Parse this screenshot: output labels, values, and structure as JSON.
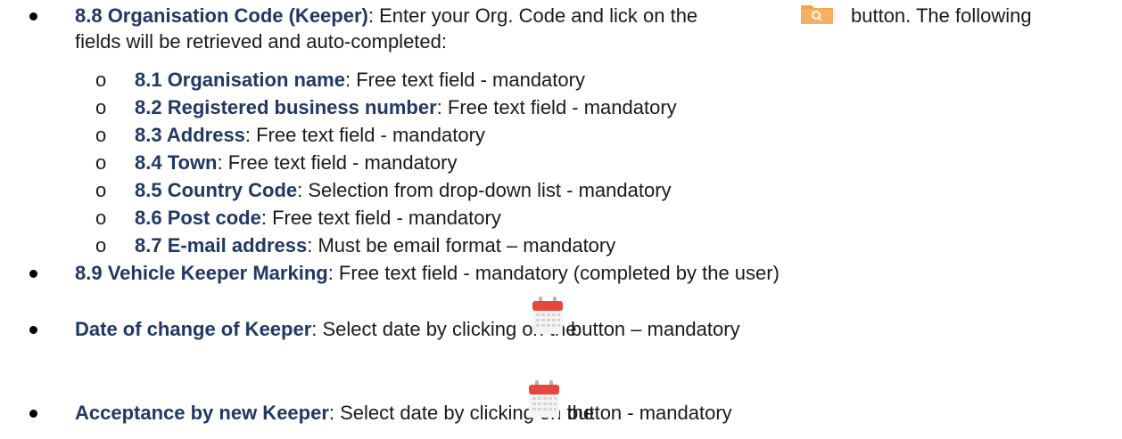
{
  "items": [
    {
      "title": "8.8 Organisation Code (Keeper)",
      "text_before_icon": ": Enter your Org. Code and lick on the",
      "text_after_icon": "button. The following",
      "continuation": "fields will be retrieved and auto-completed:",
      "icon": "folder-search-icon"
    },
    {
      "title": "8.9 Vehicle Keeper Marking",
      "text": ": Free text field - mandatory (completed by the user)"
    },
    {
      "title": "Date of change of Keeper",
      "text_before_icon": ": Select date by clicking on the",
      "text_after_icon": "button – mandatory",
      "icon": "calendar-icon"
    },
    {
      "title": "Acceptance by new Keeper",
      "text_before_icon": ": Select date by clicking on the",
      "text_after_icon": "button - mandatory",
      "icon": "calendar-icon"
    }
  ],
  "subitems": [
    {
      "marker": "o",
      "title": "8.1 Organisation name",
      "text": ": Free text field - mandatory"
    },
    {
      "marker": "o",
      "title": "8.2 Registered business number",
      "text": ": Free text field - mandatory"
    },
    {
      "marker": "o",
      "title": "8.3 Address",
      "text": ": Free text field - mandatory"
    },
    {
      "marker": "o",
      "title": "8.4 Town",
      "text": ": Free text field - mandatory"
    },
    {
      "marker": "o",
      "title": "8.5 Country Code",
      "text": ": Selection from drop-down list - mandatory"
    },
    {
      "marker": "o",
      "title": "8.6 Post code",
      "text": ": Free text field - mandatory"
    },
    {
      "marker": "o",
      "title": "8.7 E-mail address",
      "text": ": Must be email format – mandatory"
    }
  ],
  "colors": {
    "heading": "#1f3864",
    "folder_icon": "#f5a64a",
    "calendar_header": "#e5453c"
  }
}
